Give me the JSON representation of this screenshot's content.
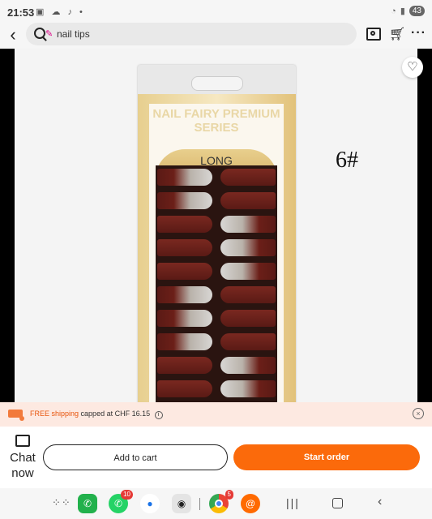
{
  "status_bar": {
    "time": "21:53",
    "battery": "43"
  },
  "search": {
    "query": "nail tips"
  },
  "product": {
    "variant_label": "6#",
    "package_brand": "NAIL FAIRY PREMIUM SERIES",
    "package_length": "LONG"
  },
  "shipping": {
    "free_label": "FREE shipping",
    "capped_text": "capped at CHF 16.15"
  },
  "actions": {
    "chat_label": "Chat now",
    "add_to_cart": "Add to cart",
    "start_order": "Start order"
  },
  "navbar": {
    "whatsapp_badge": "10",
    "chrome_badge": "5"
  },
  "icons": [
    "back-icon",
    "search-icon",
    "camera-icon",
    "cart-icon",
    "more-icon",
    "heart-icon",
    "truck-icon",
    "info-icon",
    "close-icon",
    "chat-icon"
  ],
  "colors": {
    "accent": "#fb6a0b",
    "banner": "#fde9e1",
    "free_shipping": "#e8560e"
  }
}
